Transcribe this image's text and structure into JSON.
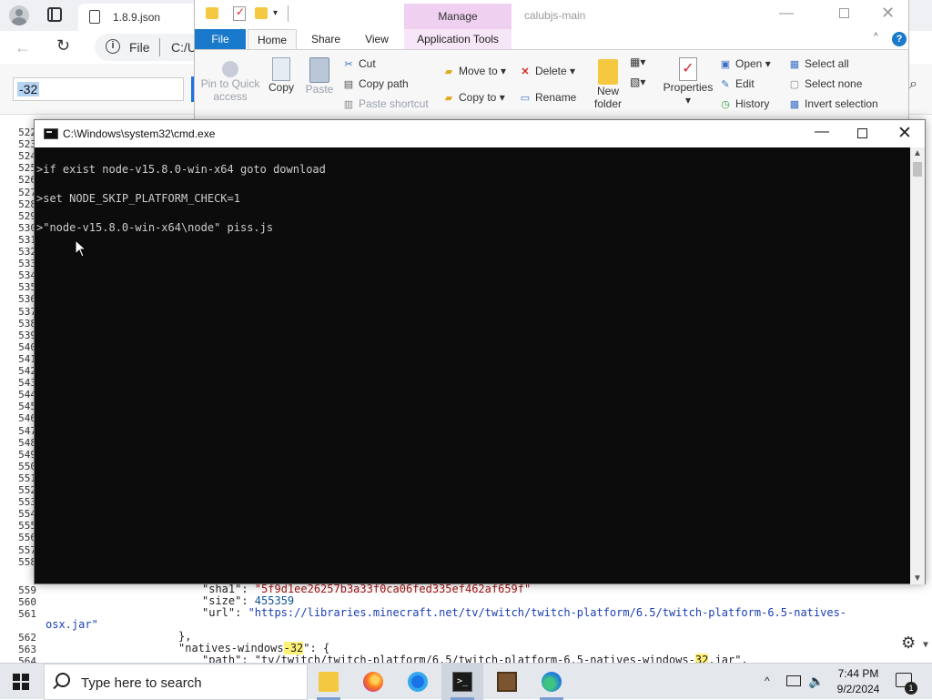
{
  "browser": {
    "tab_title": "1.8.9.json",
    "address_scheme": "File",
    "address_url": "C:/U",
    "find_query": "-32",
    "json_lines_top": [
      {
        "num": "522"
      },
      {
        "num": "523"
      },
      {
        "num": "524"
      },
      {
        "num": "525"
      },
      {
        "num": "526"
      },
      {
        "num": "527"
      },
      {
        "num": "528"
      },
      {
        "num": "529"
      },
      {
        "num": "530"
      },
      {
        "num": "531"
      },
      {
        "num": "532"
      },
      {
        "num": "533"
      },
      {
        "num": "534"
      },
      {
        "num": "535"
      },
      {
        "num": "536"
      },
      {
        "num": "537"
      },
      {
        "num": "538"
      },
      {
        "num": "539"
      },
      {
        "num": "540"
      },
      {
        "num": "541"
      },
      {
        "num": "542"
      },
      {
        "num": "543"
      },
      {
        "num": "544"
      },
      {
        "num": "545"
      },
      {
        "num": "546"
      },
      {
        "num": "547"
      },
      {
        "num": "548"
      },
      {
        "num": "549"
      },
      {
        "num": "550"
      },
      {
        "num": "551"
      },
      {
        "num": "552"
      },
      {
        "num": "553"
      },
      {
        "num": "554"
      },
      {
        "num": "555"
      },
      {
        "num": "556"
      },
      {
        "num": "557"
      },
      {
        "num": "558"
      }
    ],
    "json_tail": {
      "n559": "559",
      "l559_key": "\"sha1\": ",
      "l559_val": "\"5f9d1ee26257b3a33f0ca06fed335ef462af659f\"",
      "n560": "560",
      "l560_key": "\"size\": ",
      "l560_val": "455359",
      "n561": "561",
      "l561_key": "\"url\": ",
      "l561_val": "\"https://libraries.minecraft.net/tv/twitch/twitch-platform/6.5/twitch-platform-6.5-natives-",
      "l561b": "osx.jar\"",
      "n562": "562",
      "l562": "},",
      "n563": "563",
      "l563_a": "\"natives-windows",
      "l563_hl": "-32",
      "l563_b": "\": {",
      "n564": "564",
      "l564_a": "\"path\": \"tv/twitch/twitch-platform/6.5/twitch-platform-6.5-natives-windows-",
      "l564_hl": "32",
      "l564_b": ".jar\","
    }
  },
  "explorer": {
    "title": "calubjs-main",
    "contextual_tab": "Manage",
    "tabs": {
      "file": "File",
      "home": "Home",
      "share": "Share",
      "view": "View",
      "app_tools": "Application Tools"
    },
    "ribbon": {
      "pin": "Pin to Quick access",
      "copy": "Copy",
      "paste": "Paste",
      "cut": "Cut",
      "copy_path": "Copy path",
      "paste_shortcut": "Paste shortcut",
      "move_to": "Move to",
      "copy_to": "Copy to",
      "delete": "Delete",
      "rename": "Rename",
      "new_folder": "New folder",
      "properties": "Properties",
      "open": "Open",
      "edit": "Edit",
      "history": "History",
      "select_all": "Select all",
      "select_none": "Select none",
      "invert_selection": "Invert selection"
    }
  },
  "cmd": {
    "title": "C:\\Windows\\system32\\cmd.exe",
    "lines": [
      ">if exist node-v15.8.0-win-x64 goto download",
      ">set NODE_SKIP_PLATFORM_CHECK=1",
      ">\"node-v15.8.0-win-x64\\node\" piss.js"
    ]
  },
  "taskbar": {
    "search_placeholder": "Type here to search",
    "time": "7:44 PM",
    "date": "9/2/2024",
    "notification_count": "1",
    "apps": [
      "file-explorer",
      "firefox",
      "chrome",
      "terminal",
      "minecraft",
      "edge"
    ]
  },
  "colors": {
    "accent": "#1979ca",
    "cmd_bg": "#0c0c0c",
    "cmd_text": "#cccccc",
    "highlight": "#fff176",
    "manage_tab": "#f0d0f0"
  }
}
